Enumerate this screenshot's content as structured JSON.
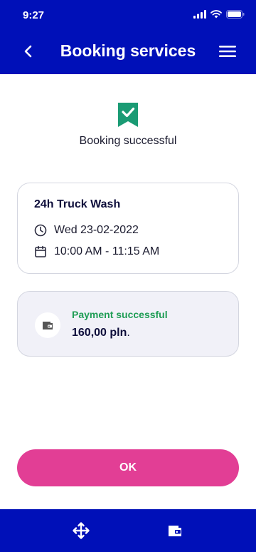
{
  "status_bar": {
    "time": "9:27"
  },
  "header": {
    "title": "Booking services",
    "back_icon": "chevron-left-icon",
    "menu_icon": "hamburger-menu-icon"
  },
  "confirmation": {
    "icon": "bookmark-check-icon",
    "message": "Booking successful",
    "accent": "#1a9b74"
  },
  "booking": {
    "service": "24h Truck Wash",
    "date": "Wed 23-02-2022",
    "time": "10:00 AM - 11:15 AM"
  },
  "payment": {
    "status": "Payment successful",
    "amount": "160,00 pln",
    "amount_suffix": ".",
    "status_color": "#1f9d55"
  },
  "actions": {
    "ok_label": "OK",
    "ok_color": "#e23e95"
  },
  "bottom_nav": {
    "items": [
      "move-arrows-icon",
      "wallet-icon"
    ],
    "bar_color": "#0010b8"
  }
}
